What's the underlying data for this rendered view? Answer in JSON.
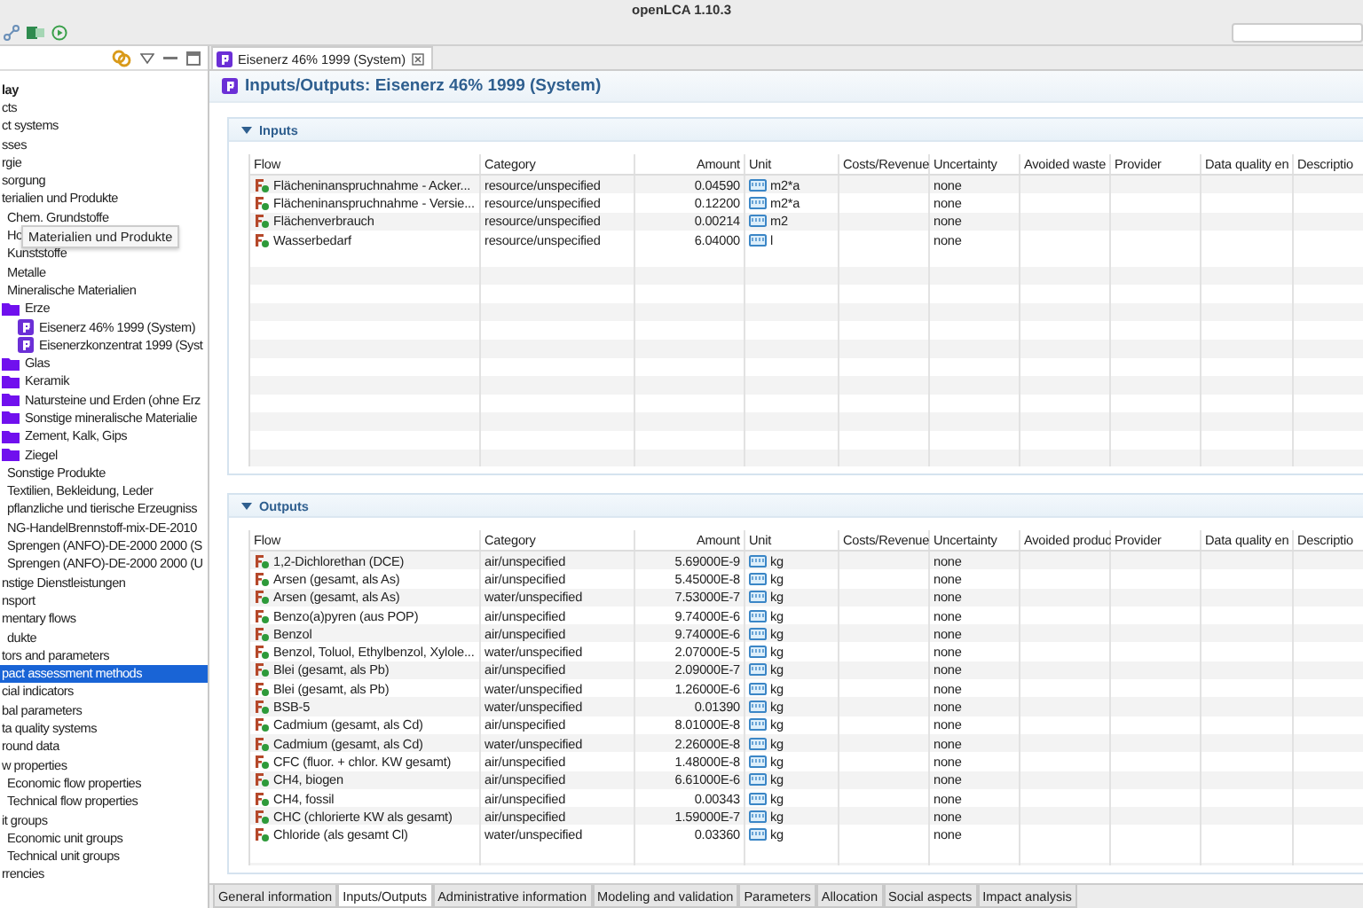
{
  "window": {
    "title": "openLCA 1.10.3"
  },
  "navigator": {
    "tooltip": "Materialien und Produkte",
    "items": [
      {
        "label": "lay",
        "selected": false,
        "bold": true
      },
      {
        "label": "cts",
        "selected": false
      },
      {
        "label": "ct systems",
        "selected": false
      },
      {
        "label": "sses",
        "selected": false
      },
      {
        "label": "rgie",
        "selected": false
      },
      {
        "label": "sorgung",
        "selected": false
      },
      {
        "label": "terialien und Produkte",
        "selected": false,
        "children": [
          {
            "label": "Chem. Grundstoffe",
            "selected": false
          },
          {
            "label": "Ho",
            "selected": false
          },
          {
            "label": "Kunststoffe",
            "selected": false
          },
          {
            "label": "Metalle",
            "selected": false
          },
          {
            "label": "Mineralische Materialien",
            "selected": false,
            "children": [
              {
                "label": "Erze",
                "kind": "folder",
                "selected": false,
                "children": [
                  {
                    "label": "Eisenerz 46% 1999 (System)",
                    "kind": "process",
                    "selected": false
                  },
                  {
                    "label": "Eisenerzkonzentrat 1999 (Syst",
                    "kind": "process",
                    "selected": false
                  }
                ]
              },
              {
                "label": "Glas",
                "kind": "folder",
                "selected": false
              },
              {
                "label": "Keramik",
                "kind": "folder",
                "selected": false
              },
              {
                "label": "Natursteine und Erden (ohne Erz",
                "kind": "folder",
                "selected": false
              },
              {
                "label": "Sonstige mineralische Materialie",
                "kind": "folder",
                "selected": false
              },
              {
                "label": "Zement, Kalk, Gips",
                "kind": "folder",
                "selected": false
              },
              {
                "label": "Ziegel",
                "kind": "folder",
                "selected": false
              }
            ]
          },
          {
            "label": "Sonstige Produkte",
            "selected": false
          },
          {
            "label": "Textilien, Bekleidung, Leder",
            "selected": false
          },
          {
            "label": "pflanzliche und tierische Erzeugniss",
            "selected": false
          },
          {
            "label": "NG-HandelBrennstoff-mix-DE-2010",
            "selected": false
          },
          {
            "label": "Sprengen (ANFO)-DE-2000 2000 (S",
            "selected": false
          },
          {
            "label": "Sprengen (ANFO)-DE-2000 2000 (U",
            "selected": false
          }
        ]
      },
      {
        "label": "nstige Dienstleistungen",
        "selected": false
      },
      {
        "label": "nsport",
        "selected": false
      },
      {
        "label": "mentary flows",
        "selected": false,
        "children": [
          {
            "label": "dukte",
            "selected": false
          }
        ]
      },
      {
        "label": "tors and parameters",
        "selected": false
      },
      {
        "label": "pact assessment methods",
        "selected": true
      },
      {
        "label": "cial indicators",
        "selected": false
      },
      {
        "label": "bal parameters",
        "selected": false
      },
      {
        "label": "ta quality systems",
        "selected": false
      },
      {
        "label": "round data",
        "selected": false
      },
      {
        "label": "w properties",
        "selected": false,
        "children": [
          {
            "label": "Economic flow properties",
            "selected": false
          },
          {
            "label": "Technical flow properties",
            "selected": false
          }
        ]
      },
      {
        "label": "it groups",
        "selected": false,
        "children": [
          {
            "label": "Economic unit groups",
            "selected": false
          },
          {
            "label": "Technical unit groups",
            "selected": false
          }
        ]
      },
      {
        "label": "rrencies",
        "selected": false
      }
    ]
  },
  "editor": {
    "tab": "Eisenerz 46% 1999 (System)",
    "title": "Inputs/Outputs: Eisenerz 46% 1999 (System)",
    "sections": [
      {
        "title": "Inputs",
        "expanded": true,
        "columns": [
          "Flow",
          "Category",
          "Amount",
          "Unit",
          "Costs/Revenue",
          "Uncertainty",
          "Avoided waste",
          "Provider",
          "Data quality en",
          "Descriptio"
        ],
        "rows": [
          {
            "flow": "Flächeninanspruchnahme - Acker...",
            "category": "resource/unspecified",
            "amount": "0.04590",
            "unit": "m2*a",
            "uncertainty": "none"
          },
          {
            "flow": "Flächeninanspruchnahme - Versie...",
            "category": "resource/unspecified",
            "amount": "0.12200",
            "unit": "m2*a",
            "uncertainty": "none"
          },
          {
            "flow": "Flächenverbrauch",
            "category": "resource/unspecified",
            "amount": "0.00214",
            "unit": "m2",
            "uncertainty": "none"
          },
          {
            "flow": "Wasserbedarf",
            "category": "resource/unspecified",
            "amount": "6.04000",
            "unit": "l",
            "uncertainty": "none"
          }
        ]
      },
      {
        "title": "Outputs",
        "expanded": true,
        "columns": [
          "Flow",
          "Category",
          "Amount",
          "Unit",
          "Costs/Revenue",
          "Uncertainty",
          "Avoided produc",
          "Provider",
          "Data quality en",
          "Descriptio"
        ],
        "rows": [
          {
            "flow": "1,2-Dichlorethan (DCE)",
            "category": "air/unspecified",
            "amount": "5.69000E-9",
            "unit": "kg",
            "uncertainty": "none"
          },
          {
            "flow": "Arsen (gesamt, als As)",
            "category": "air/unspecified",
            "amount": "5.45000E-8",
            "unit": "kg",
            "uncertainty": "none"
          },
          {
            "flow": "Arsen (gesamt, als As)",
            "category": "water/unspecified",
            "amount": "7.53000E-7",
            "unit": "kg",
            "uncertainty": "none"
          },
          {
            "flow": "Benzo(a)pyren (aus POP)",
            "category": "air/unspecified",
            "amount": "9.74000E-6",
            "unit": "kg",
            "uncertainty": "none"
          },
          {
            "flow": "Benzol",
            "category": "air/unspecified",
            "amount": "9.74000E-6",
            "unit": "kg",
            "uncertainty": "none"
          },
          {
            "flow": "Benzol, Toluol, Ethylbenzol, Xylole...",
            "category": "water/unspecified",
            "amount": "2.07000E-5",
            "unit": "kg",
            "uncertainty": "none"
          },
          {
            "flow": "Blei (gesamt, als Pb)",
            "category": "air/unspecified",
            "amount": "2.09000E-7",
            "unit": "kg",
            "uncertainty": "none"
          },
          {
            "flow": "Blei (gesamt, als Pb)",
            "category": "water/unspecified",
            "amount": "1.26000E-6",
            "unit": "kg",
            "uncertainty": "none"
          },
          {
            "flow": "BSB-5",
            "category": "water/unspecified",
            "amount": "0.01390",
            "unit": "kg",
            "uncertainty": "none"
          },
          {
            "flow": "Cadmium (gesamt, als Cd)",
            "category": "air/unspecified",
            "amount": "8.01000E-8",
            "unit": "kg",
            "uncertainty": "none"
          },
          {
            "flow": "Cadmium (gesamt, als Cd)",
            "category": "water/unspecified",
            "amount": "2.26000E-8",
            "unit": "kg",
            "uncertainty": "none"
          },
          {
            "flow": "CFC (fluor. + chlor. KW gesamt)",
            "category": "air/unspecified",
            "amount": "1.48000E-8",
            "unit": "kg",
            "uncertainty": "none"
          },
          {
            "flow": "CH4, biogen",
            "category": "air/unspecified",
            "amount": "6.61000E-6",
            "unit": "kg",
            "uncertainty": "none"
          },
          {
            "flow": "CH4, fossil",
            "category": "air/unspecified",
            "amount": "0.00343",
            "unit": "kg",
            "uncertainty": "none"
          },
          {
            "flow": "CHC (chlorierte KW als gesamt)",
            "category": "air/unspecified",
            "amount": "1.59000E-7",
            "unit": "kg",
            "uncertainty": "none"
          },
          {
            "flow": "Chloride (als gesamt Cl)",
            "category": "water/unspecified",
            "amount": "0.03360",
            "unit": "kg",
            "uncertainty": "none"
          }
        ]
      }
    ],
    "page_tabs": [
      {
        "label": "General information",
        "selected": false
      },
      {
        "label": "Inputs/Outputs",
        "selected": true
      },
      {
        "label": "Administrative information",
        "selected": false
      },
      {
        "label": "Modeling and validation",
        "selected": false
      },
      {
        "label": "Parameters",
        "selected": false
      },
      {
        "label": "Allocation",
        "selected": false
      },
      {
        "label": "Social aspects",
        "selected": false
      },
      {
        "label": "Impact analysis",
        "selected": false
      }
    ]
  }
}
